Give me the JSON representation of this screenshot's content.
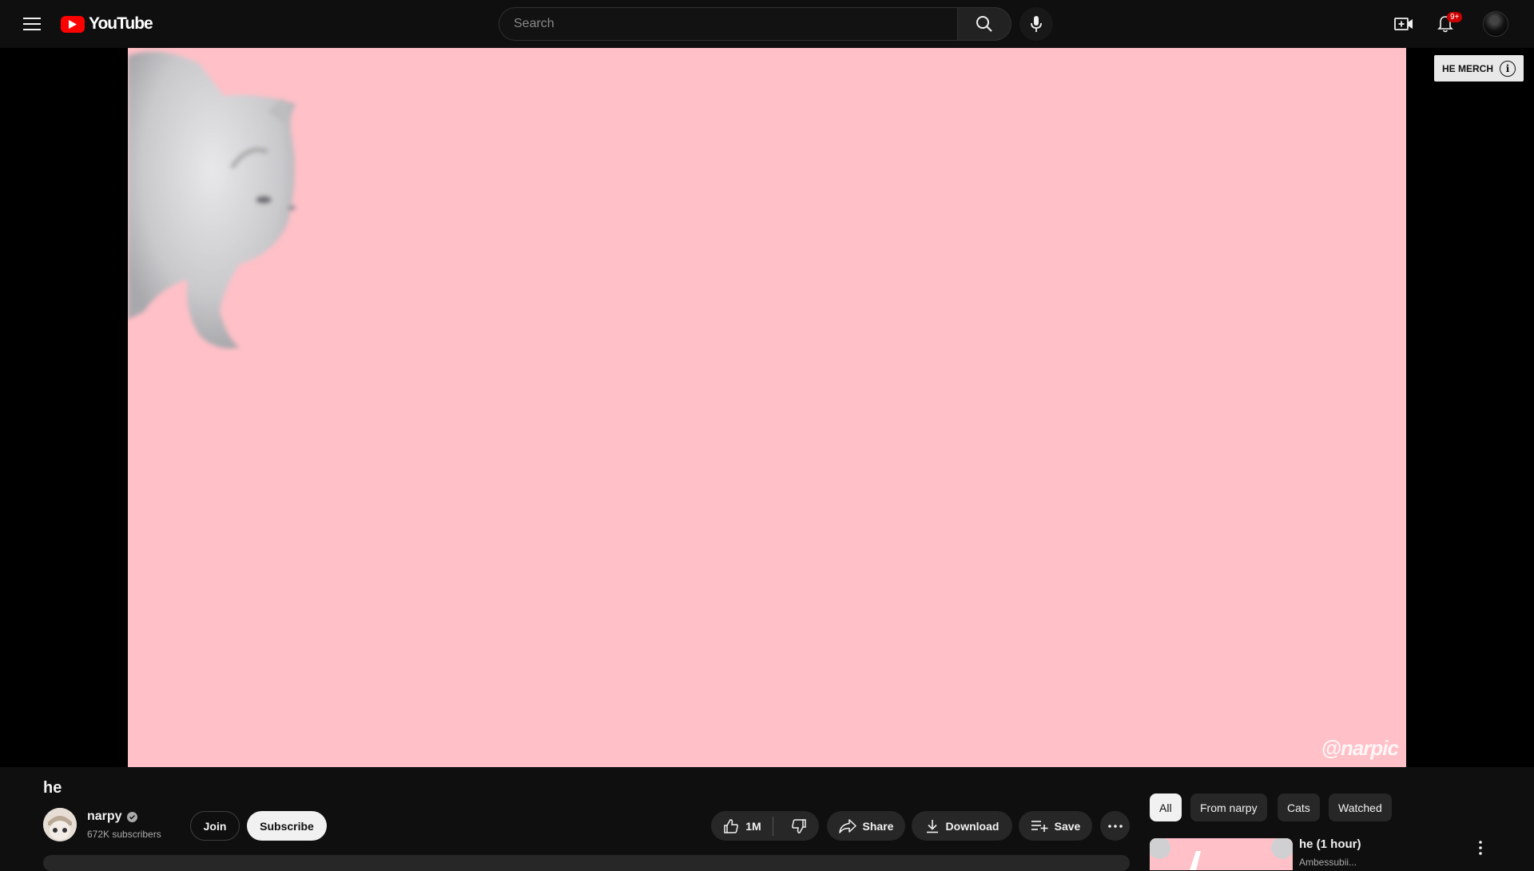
{
  "header": {
    "logo_text": "YouTube",
    "search_placeholder": "Search",
    "notification_count": "9+"
  },
  "player": {
    "watermark": "@narpic",
    "merch_label": "HE MERCH"
  },
  "video": {
    "title": "he",
    "channel_name": "narpy",
    "subscribers": "672K subscribers",
    "join_label": "Join",
    "subscribe_label": "Subscribe",
    "like_count": "1M",
    "share_label": "Share",
    "download_label": "Download",
    "save_label": "Save"
  },
  "sidebar": {
    "chips": [
      {
        "label": "All",
        "active": true
      },
      {
        "label": "From narpy",
        "active": false
      },
      {
        "label": "Cats",
        "active": false
      },
      {
        "label": "Watched",
        "active": false
      }
    ],
    "recommendations": [
      {
        "title": "he (1 hour)",
        "channel": "Ambessubii..."
      }
    ]
  },
  "colors": {
    "background": "#0f0f0f",
    "video_pink": "#ffc0c7",
    "brand_red": "#ff0000"
  },
  "icons": [
    "hamburger-menu-icon",
    "youtube-play-icon",
    "search-icon",
    "microphone-icon",
    "create-video-icon",
    "bell-icon",
    "info-icon",
    "thumbs-up-icon",
    "thumbs-down-icon",
    "share-icon",
    "download-icon",
    "playlist-add-icon",
    "more-horizontal-icon",
    "more-vertical-icon",
    "verified-check-icon"
  ]
}
